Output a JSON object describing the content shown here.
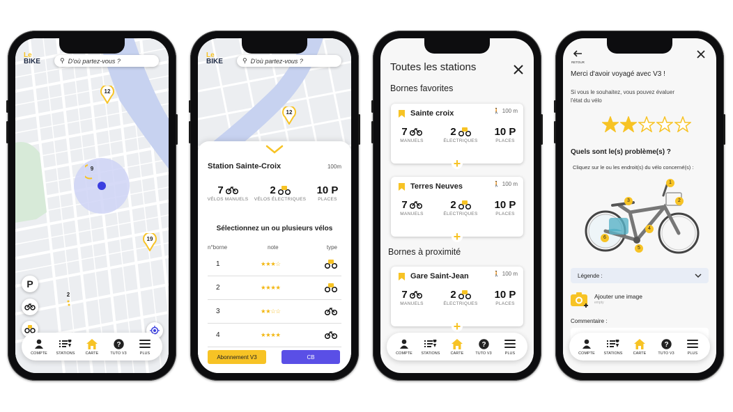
{
  "colors": {
    "accent": "#f7c325",
    "map_bg": "#eceef1",
    "river": "#c7d2f0",
    "park": "#d7ead8",
    "location": "#3b3fe0",
    "purple": "#5a4fe6"
  },
  "tabbar": [
    {
      "label": "COMPTE",
      "icon": "user-icon"
    },
    {
      "label": "STATIONS",
      "icon": "stations-icon"
    },
    {
      "label": "CARTE",
      "icon": "home-icon"
    },
    {
      "label": "TUTO V3",
      "icon": "help-icon"
    },
    {
      "label": "PLUS",
      "icon": "menu-icon"
    }
  ],
  "phone1": {
    "logo_top": "Le",
    "logo_bottom": "BIKE",
    "search_placeholder": "D'où partez-vous ?",
    "markers": [
      "12",
      "9",
      "19",
      "2"
    ],
    "parking_label": "P"
  },
  "phone2": {
    "logo_top": "Le",
    "logo_bottom": "BIKE",
    "search_placeholder": "D'où partez-vous ?",
    "marker": "12",
    "station_name": "Station Sainte-Croix",
    "distance": "100m",
    "manual_count": "7",
    "manual_label": "VÉLOS MANUELS",
    "electric_count": "2",
    "electric_label": "VÉLOS ÉLECTRIQUES",
    "places_count": "10 P",
    "places_label": "PLACES",
    "select_title": "Sélectionnez un ou plusieurs vélos",
    "col_borne": "n°borne",
    "col_note": "note",
    "col_type": "type",
    "rows": [
      {
        "borne": "1",
        "stars": "★★★☆",
        "type": "electric"
      },
      {
        "borne": "2",
        "stars": "★★★★",
        "type": "electric"
      },
      {
        "borne": "3",
        "stars": "★★☆☆",
        "type": "manual"
      },
      {
        "borne": "4",
        "stars": "★★★★",
        "type": "manual"
      }
    ],
    "btn_subscription": "Abonnement V3",
    "btn_cb": "CB"
  },
  "phone3": {
    "title": "Toutes les stations",
    "section_favorites": "Bornes favorites",
    "section_nearby": "Bornes à proximité",
    "stations": [
      {
        "name": "Sainte croix",
        "distance": "100 m",
        "manual": "7",
        "manual_label": "MANUELS",
        "electric": "2",
        "electric_label": "ÉLECTRIQUES",
        "places": "10 P",
        "places_label": "PLACES"
      },
      {
        "name": "Terres Neuves",
        "distance": "100 m",
        "manual": "7",
        "manual_label": "MANUELS",
        "electric": "2",
        "electric_label": "ÉLECTRIQUES",
        "places": "10 P",
        "places_label": "PLACES"
      },
      {
        "name": "Gare Saint-Jean",
        "distance": "100 m",
        "manual": "7",
        "manual_label": "MANUELS",
        "electric": "2",
        "electric_label": "ÉLECTRIQUES",
        "places": "10 P",
        "places_label": "PLACES"
      }
    ]
  },
  "phone4": {
    "back_label": "RETOUR",
    "thanks": "Merci d'avoir voyagé avec V3 !",
    "rate_text": "Si vous le souhaitez, vous pouvez évaluer l'état du vélo",
    "rating": 2,
    "rating_max": 5,
    "problem_title": "Quels sont le(s) problème(s) ?",
    "problem_hint": "Cliquez sur le ou les endroit(s) du vélo concerné(s) :",
    "bike_points": [
      "1",
      "2",
      "3",
      "4",
      "5",
      "6"
    ],
    "legend_label": "Légende :",
    "add_image": "Ajouter une image",
    "add_image_sub": "empty",
    "comment_label": "Commentaire :"
  }
}
